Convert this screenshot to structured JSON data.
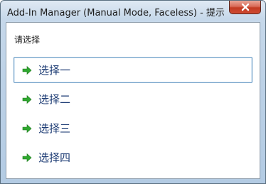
{
  "window": {
    "title": "Add-In Manager (Manual Mode, Faceless) - 提示",
    "close_icon": "close-icon"
  },
  "dialog": {
    "prompt": "请选择",
    "options": [
      {
        "label": "选择一",
        "icon": "green-arrow-icon",
        "selected": true
      },
      {
        "label": "选择二",
        "icon": "green-arrow-icon",
        "selected": false
      },
      {
        "label": "选择三",
        "icon": "green-arrow-icon",
        "selected": false
      },
      {
        "label": "选择四",
        "icon": "green-arrow-icon",
        "selected": false
      }
    ]
  },
  "colors": {
    "arrow": "#2fa82f",
    "option_text": "#1b3a73",
    "selection_border": "#6d9dc6"
  }
}
